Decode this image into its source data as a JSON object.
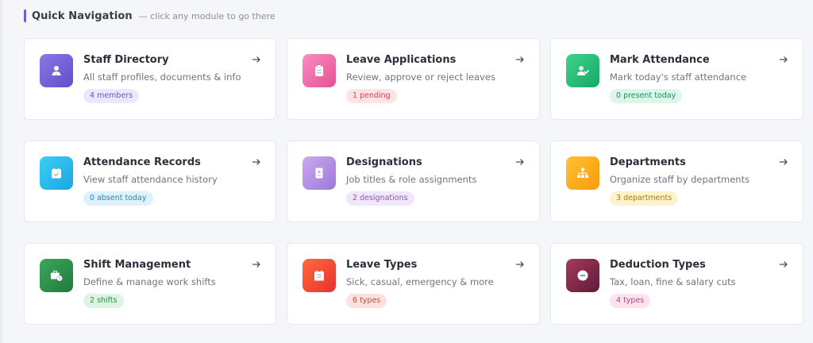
{
  "header": {
    "title": "Quick Navigation",
    "hint": "— click any module to go there",
    "accent_color": "#6c5fd4"
  },
  "modules": [
    {
      "title": "Staff Directory",
      "description": "All staff profiles, documents & info",
      "badge": "4 members",
      "icon": "person-icon",
      "gradient": [
        "#8a78e6",
        "#5f4fc9"
      ],
      "badge_bg": "#ece7fd",
      "badge_fg": "#6a54c9"
    },
    {
      "title": "Leave Applications",
      "description": "Review, approve or reject leaves",
      "badge": "1 pending",
      "icon": "clipboard-icon",
      "gradient": [
        "#f78fc3",
        "#e64f93"
      ],
      "badge_bg": "#fde3e6",
      "badge_fg": "#cf4455"
    },
    {
      "title": "Mark Attendance",
      "description": "Mark today's staff attendance",
      "badge": "0 present today",
      "icon": "user-check-icon",
      "gradient": [
        "#3ed48a",
        "#15a865"
      ],
      "badge_bg": "#dcf6ea",
      "badge_fg": "#1d8f59"
    },
    {
      "title": "Attendance Records",
      "description": "View staff attendance history",
      "badge": "0 absent today",
      "icon": "calendar-check-icon",
      "gradient": [
        "#39d0f0",
        "#1fa3e6"
      ],
      "badge_bg": "#dff1fb",
      "badge_fg": "#2a86b8"
    },
    {
      "title": "Designations",
      "description": "Job titles & role assignments",
      "badge": "2 designations",
      "icon": "id-badge-icon",
      "gradient": [
        "#c9a9ef",
        "#9d79d8"
      ],
      "badge_bg": "#f1e7fb",
      "badge_fg": "#8a55c4"
    },
    {
      "title": "Departments",
      "description": "Organize staff by departments",
      "badge": "3 departments",
      "icon": "sitemap-icon",
      "gradient": [
        "#ffc233",
        "#f79a0b"
      ],
      "badge_bg": "#fdf3cf",
      "badge_fg": "#a97a12"
    },
    {
      "title": "Shift Management",
      "description": "Define & manage work shifts",
      "badge": "2 shifts",
      "icon": "briefcase-clock-icon",
      "gradient": [
        "#3aa85a",
        "#217a3d"
      ],
      "badge_bg": "#dff5e4",
      "badge_fg": "#2b8a46"
    },
    {
      "title": "Leave Types",
      "description": "Sick, casual, emergency & more",
      "badge": "6 types",
      "icon": "calendar-minus-icon",
      "gradient": [
        "#ff6a3d",
        "#e8312f"
      ],
      "badge_bg": "#fbe2df",
      "badge_fg": "#c8473a"
    },
    {
      "title": "Deduction Types",
      "description": "Tax, loan, fine & salary cuts",
      "badge": "4 types",
      "icon": "minus-circle-icon",
      "gradient": [
        "#a83a5a",
        "#5e1a3c"
      ],
      "badge_bg": "#fce3ef",
      "badge_fg": "#b5477c"
    }
  ]
}
